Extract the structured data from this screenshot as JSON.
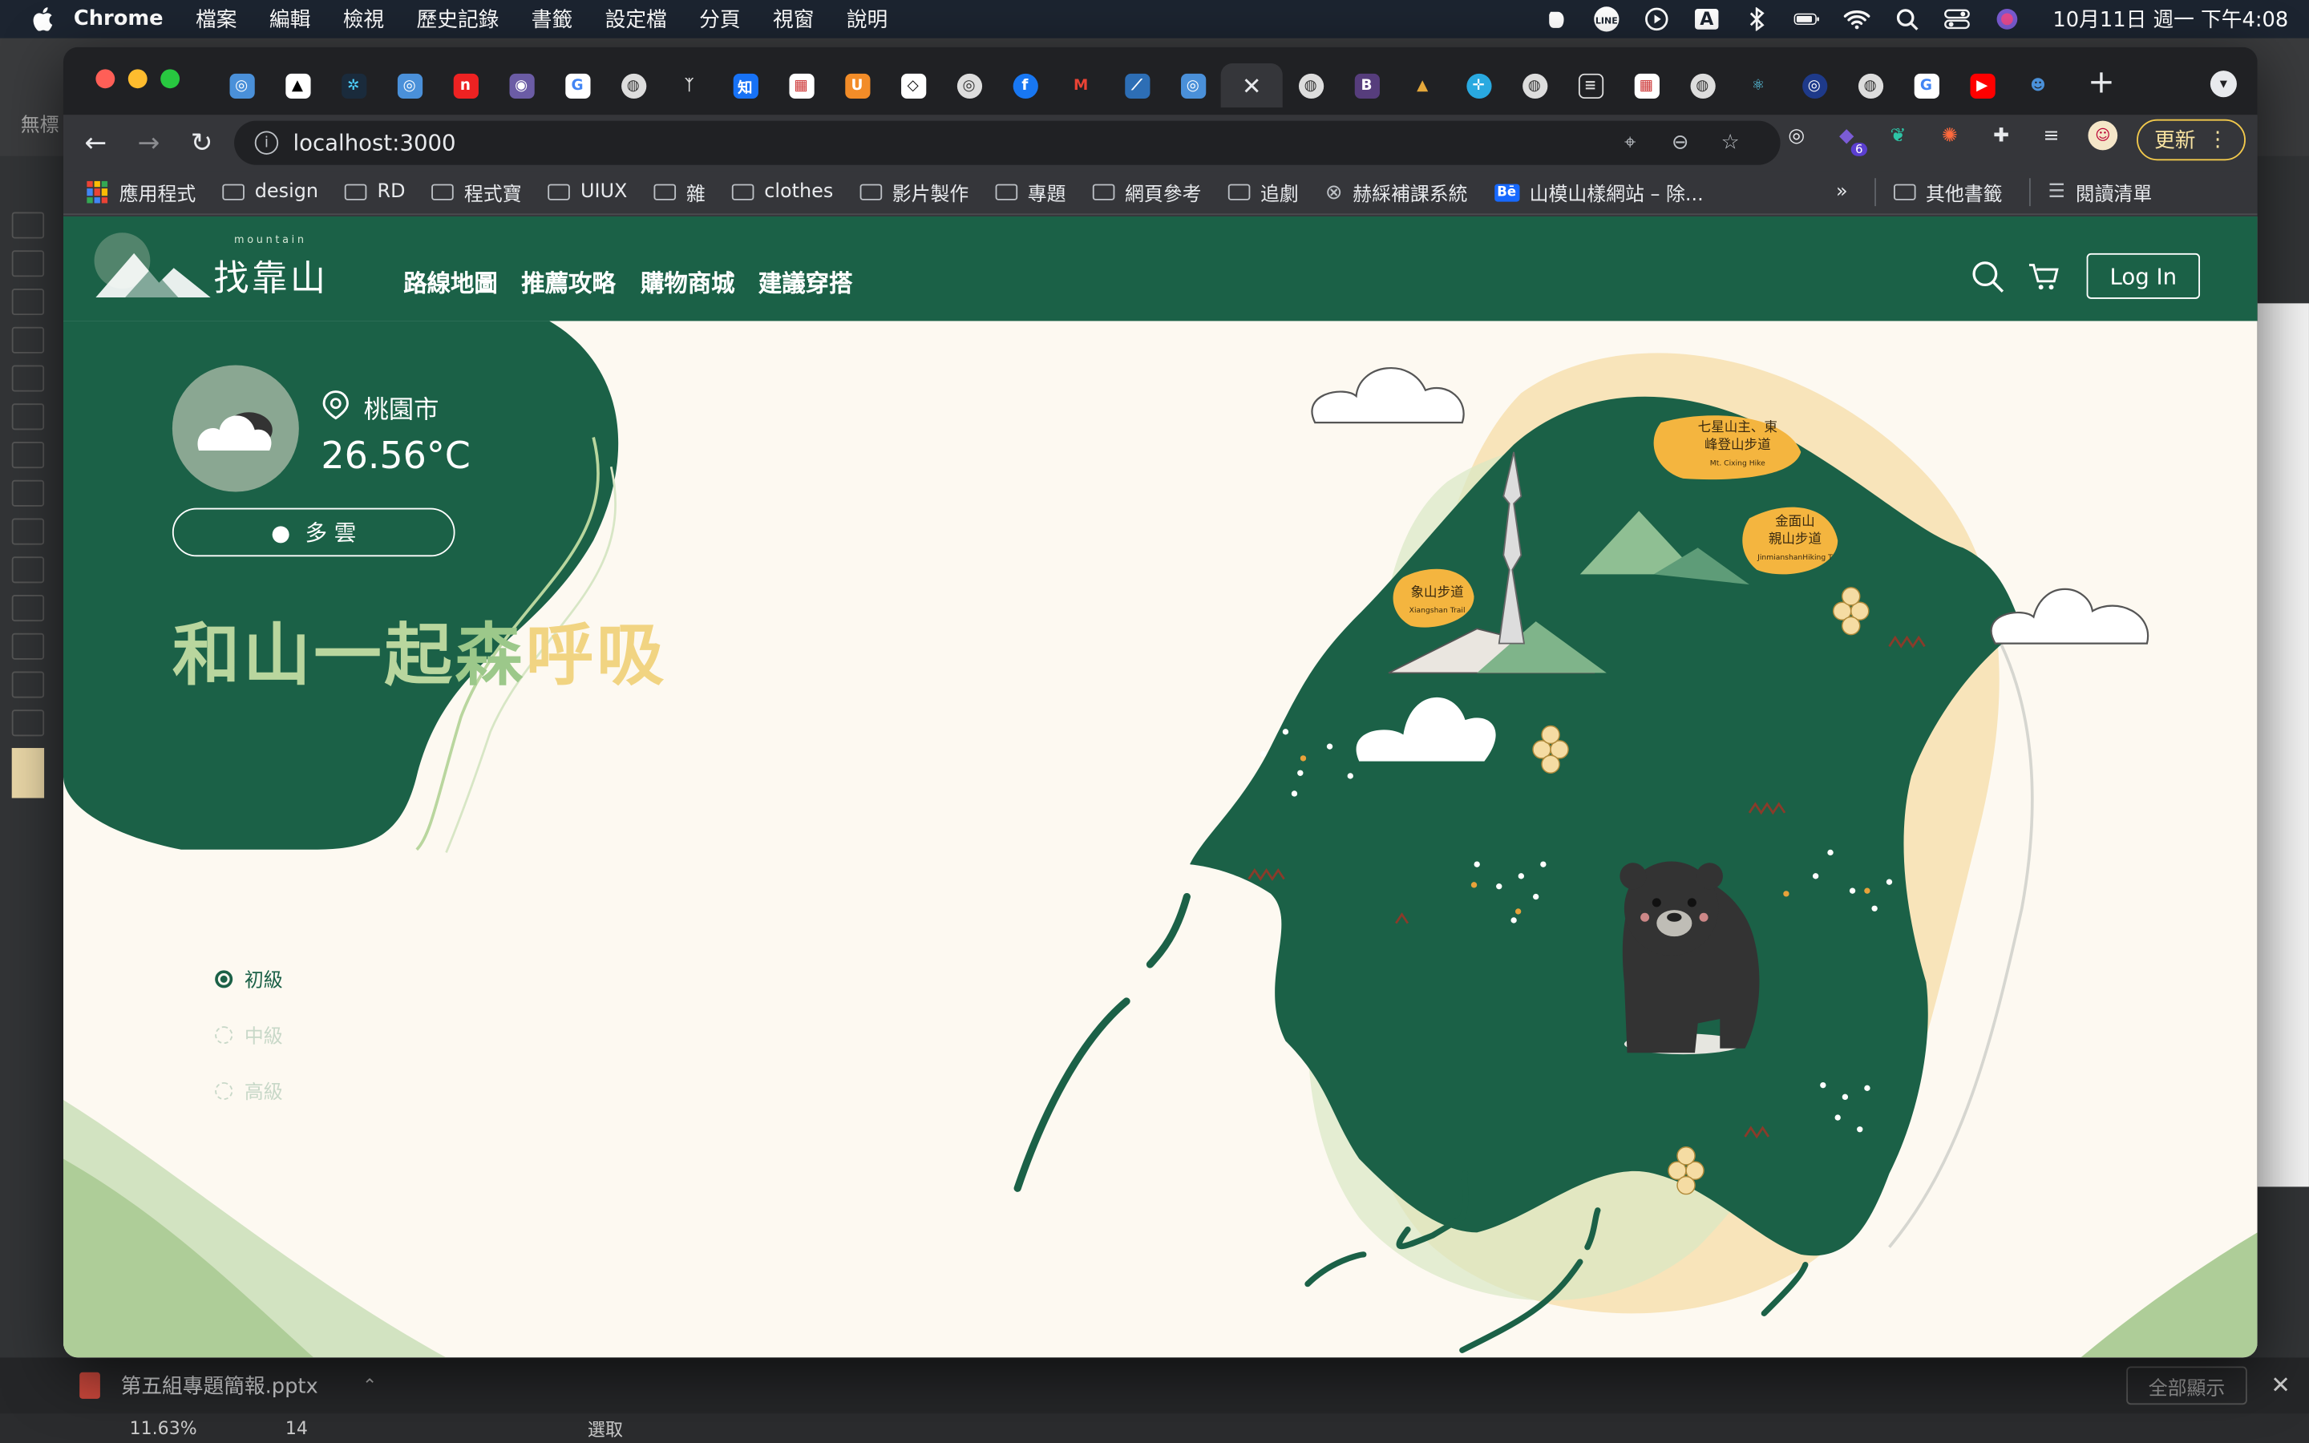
{
  "menubar": {
    "app": "Chrome",
    "items": [
      "檔案",
      "編輯",
      "檢視",
      "歷史記錄",
      "書籤",
      "設定檔",
      "分頁",
      "視窗",
      "說明"
    ],
    "clock": "10月11日 週一 下午4:08",
    "input_indicator": "A"
  },
  "browser": {
    "url": "localhost:3000",
    "update_label": "更新",
    "ext_badge": "6",
    "bookmarks": [
      "應用程式",
      "design",
      "RD",
      "程式寶",
      "UIUX",
      "雜",
      "clothes",
      "影片製作",
      "專題",
      "網頁參考",
      "追劇",
      "赫綵補課系統",
      "山模山樣網站 – 除..."
    ],
    "bookmarks_more": "»",
    "other_bookmarks": "其他書籤",
    "reading_list": "閱讀清單",
    "tab_letters": {
      "zhi": "知",
      "u": "U",
      "b": "B"
    }
  },
  "site": {
    "logo_small": "mountain",
    "logo_text": "找靠山",
    "nav": [
      "路線地圖",
      "推薦攻略",
      "購物商城",
      "建議穿搭"
    ],
    "login": "Log In",
    "weather": {
      "city": "桃園市",
      "temp": "26.56°C",
      "desc": "多 雲"
    },
    "slogan": [
      "和山一起",
      "森",
      "呼吸"
    ],
    "levels": [
      "初級",
      "中級",
      "高級"
    ],
    "map_labels": {
      "qixing": "七星山主、東",
      "qixing2": "峰登山步道",
      "qixing_en": "Mt. Cixing Hike",
      "jinmian": "金面山",
      "jinmian2": "親山步道",
      "jinmian_en": "JinmianshanHiking T",
      "xiangshan": "象山步道",
      "xiangshan_en": "Xiangshan Trail"
    }
  },
  "downloads": {
    "file": "第五組專題簡報.pptx",
    "show_all": "全部顯示"
  },
  "bgapp": {
    "zoom": "11.63%",
    "page": "14",
    "mode": "選取",
    "partial_title": "無標"
  },
  "colors": {
    "brand_green": "#1b6147",
    "cream": "#fdf9f1",
    "accent_yellow": "#f2c94c"
  }
}
